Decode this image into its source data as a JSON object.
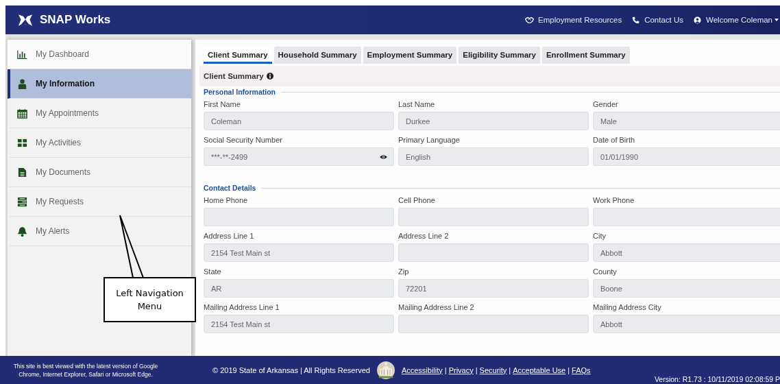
{
  "header": {
    "title": "SNAP Works",
    "links": [
      {
        "kind": "handshake",
        "label": "Employment Resources"
      },
      {
        "kind": "phone",
        "label": "Contact Us"
      },
      {
        "kind": "user",
        "label": "Welcome Coleman"
      }
    ]
  },
  "sidebar": {
    "items": [
      {
        "kind": "chart",
        "label": "My Dashboard",
        "selected": false
      },
      {
        "kind": "person",
        "label": "My Information",
        "selected": true
      },
      {
        "kind": "calendar",
        "label": "My Appointments",
        "selected": false
      },
      {
        "kind": "grid",
        "label": "My Activities",
        "selected": false
      },
      {
        "kind": "document",
        "label": "My Documents",
        "selected": false
      },
      {
        "kind": "list",
        "label": "My Requests",
        "selected": false
      },
      {
        "kind": "bell",
        "label": "My Alerts",
        "selected": false
      }
    ]
  },
  "tabs": [
    {
      "label": "Client Summary",
      "selected": true
    },
    {
      "label": "Household Summary",
      "selected": false
    },
    {
      "label": "Employment Summary",
      "selected": false
    },
    {
      "label": "Eligibility Summary",
      "selected": false
    },
    {
      "label": "Enrollment Summary",
      "selected": false
    }
  ],
  "panel_title": "Client Summary",
  "sections": [
    {
      "title": "Personal Information",
      "fields": [
        {
          "label": "First Name",
          "value": "Coleman",
          "kind": "text"
        },
        {
          "label": "Last Name",
          "value": "Durkee",
          "kind": "text"
        },
        {
          "label": "Gender",
          "value": "Male",
          "kind": "text"
        },
        {
          "label": "Social Security Number",
          "value": "***-**-2499",
          "kind": "masked"
        },
        {
          "label": "Primary Language",
          "value": "English",
          "kind": "text"
        },
        {
          "label": "Date of Birth",
          "value": "01/01/1990",
          "kind": "text"
        }
      ]
    },
    {
      "title": "Contact Details",
      "fields": [
        {
          "label": "Home Phone",
          "kind": "text"
        },
        {
          "label": "Cell Phone",
          "kind": "text"
        },
        {
          "label": "Work Phone",
          "kind": "text"
        },
        {
          "label": "Address Line 1",
          "value": "2154 Test Main st",
          "kind": "text"
        },
        {
          "label": "Address Line 2",
          "kind": "text"
        },
        {
          "label": "City",
          "value": "Abbott",
          "kind": "text"
        },
        {
          "label": "State",
          "value": "AR",
          "kind": "text"
        },
        {
          "label": "Zip",
          "value": "72201",
          "kind": "text"
        },
        {
          "label": "County",
          "value": "Boone",
          "kind": "text"
        },
        {
          "label": "Mailing Address Line 1",
          "value": "2154 Test Main st",
          "kind": "text"
        },
        {
          "label": "Mailing Address Line 2",
          "kind": "text"
        },
        {
          "label": "Mailing Address City",
          "value": "Abbott",
          "kind": "text"
        }
      ]
    }
  ],
  "callout": {
    "text": "Left Navigation Menu"
  },
  "footer": {
    "browser_note": "This site is best viewed with the latest version of Google Chrome, Internet Explorer, Safari or Microsoft Edge.",
    "copyright": "© 2019 State of Arkansas | All Rights Reserved",
    "separator": "|",
    "links": [
      "Accessibility",
      "Privacy",
      "Security",
      "Acceptable Use",
      "FAQs"
    ],
    "version": "Version: R1.73 : 10/11/2019 02:08:59 P"
  }
}
